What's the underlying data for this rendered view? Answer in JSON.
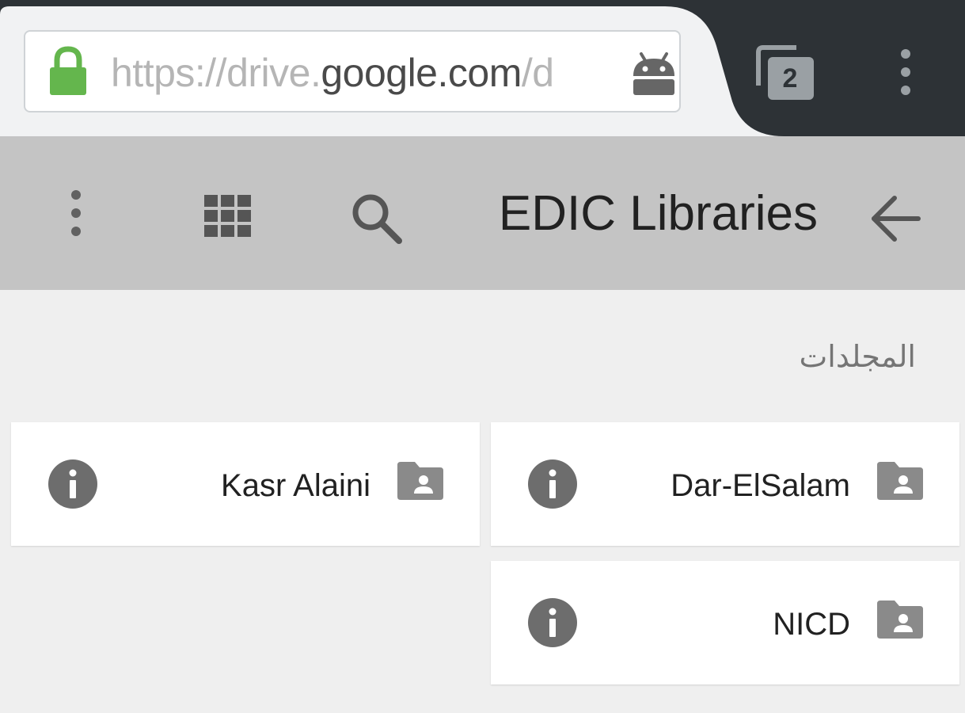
{
  "browser": {
    "url_prefix": "https://drive.",
    "url_domain": "google.com",
    "url_suffix": "/d",
    "tab_count": "2",
    "secure_icon": "lock-icon",
    "site_icon": "android-icon",
    "colors": {
      "chrome_dark": "#2d3236",
      "tab_light": "#f1f2f3",
      "lock_green": "#64b64d"
    }
  },
  "app_bar": {
    "title": "EDIC Libraries",
    "icons": [
      "more-vert-icon",
      "grid-view-icon",
      "search-icon",
      "arrow-back-icon"
    ],
    "background": "#c4c4c4"
  },
  "folders": {
    "heading": "المجلدات",
    "items": [
      {
        "name": "Dar-ElSalam",
        "icon": "shared-folder-icon"
      },
      {
        "name": "Kasr Alaini",
        "icon": "shared-folder-icon"
      },
      {
        "name": "NICD",
        "icon": "shared-folder-icon"
      }
    ]
  }
}
